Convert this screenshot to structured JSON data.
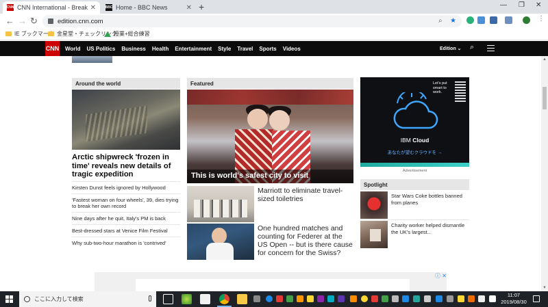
{
  "browser": {
    "tabs": [
      {
        "label": "CNN International - Breaking Ne",
        "favicon": "CNN",
        "active": true
      },
      {
        "label": "Home - BBC News",
        "favicon": "BBC",
        "active": false
      }
    ],
    "url": "edition.cnn.com",
    "bookmarks": [
      "IE ブックマーク",
      "金星堂・チェックリンク",
      "授業+総合練習"
    ]
  },
  "cnn": {
    "logo": "CNN",
    "nav": [
      "World",
      "US Politics",
      "Business",
      "Health",
      "Entertainment",
      "Style",
      "Travel",
      "Sports",
      "Videos"
    ],
    "edition": "Edition ⌄",
    "around_world": {
      "heading": "Around the world",
      "headline": "Arctic shipwreck 'frozen in time' reveals new details of tragic expedition",
      "items": [
        "Kirsten Dunst feels ignored by Hollywood",
        "'Fastest woman on four wheels', 39, dies trying to break her own record",
        "Nine days after he quit, Italy's PM is back",
        "Best-dressed stars at Venice Film Festival",
        "Why sub-two-hour marathon is 'contrived'"
      ]
    },
    "featured": {
      "heading": "Featured",
      "caption": "This is world's safest city to visit",
      "stories": [
        "Marriott to eliminate travel-sized toiletries",
        "One hundred matches and counting for Federer at the US Open -- but is there cause for concern for the Swiss?"
      ]
    },
    "ad": {
      "tagline": "Let's put smart to work.",
      "title_prefix": "IBM",
      "title_bold": "Cloud",
      "subtitle": "あなたが望むクラウドを →",
      "label": "Advertisement"
    },
    "spotlight": {
      "heading": "Spotlight",
      "items": [
        "Star Wars Coke bottles banned from planes",
        "Charity worker helped dismantle the UK's largest..."
      ]
    }
  },
  "taskbar": {
    "search_placeholder": "ここに入力して検索",
    "time": "11:07",
    "date": "2019/08/30"
  },
  "colors": {
    "cnn_red": "#cc0000",
    "nav_bg": "#0c0c0c",
    "section_bg": "#e6e6e6",
    "ibm_accent": "#1fa9a0"
  }
}
